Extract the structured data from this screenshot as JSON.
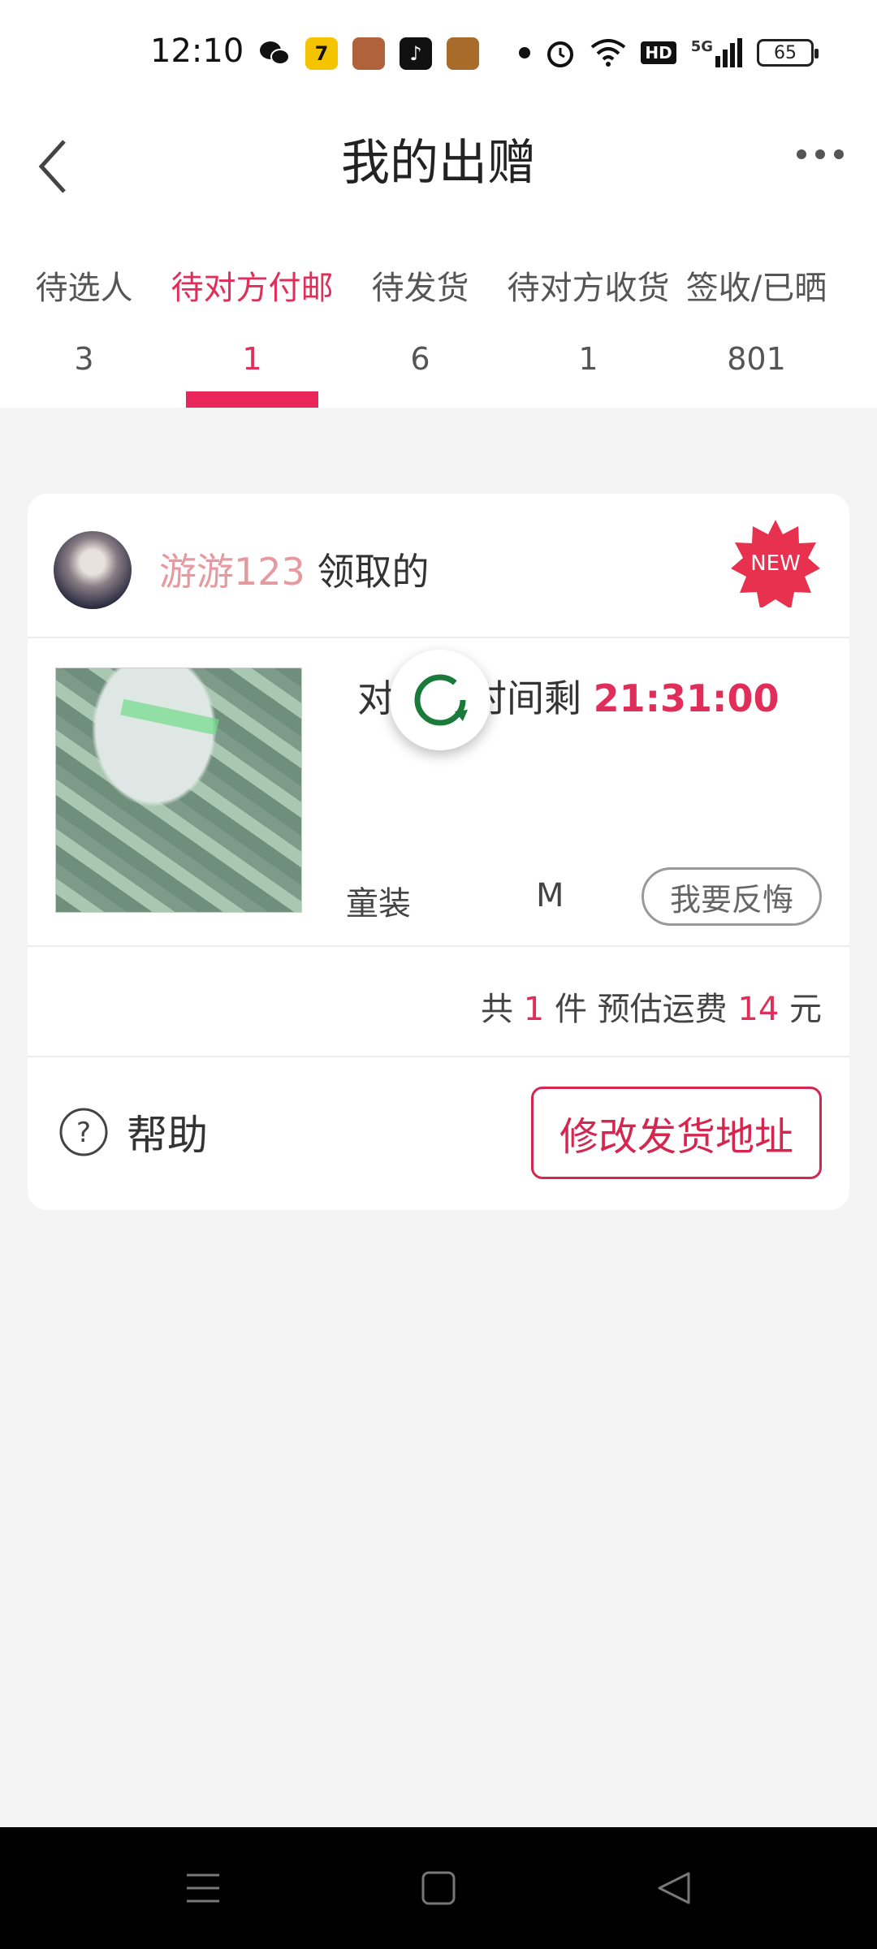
{
  "status_bar": {
    "time": "12:10",
    "network": "5G",
    "hd": "HD",
    "battery": "65",
    "app_icons": [
      "wechat-icon",
      "app-7-icon",
      "game-icon",
      "tiktok-icon",
      "game2-icon"
    ]
  },
  "header": {
    "title": "我的出赠",
    "back_icon": "chevron-left-icon",
    "more_icon": "more-dots-icon"
  },
  "tabs": [
    {
      "label": "待选人",
      "count": "3",
      "active": false
    },
    {
      "label": "待对方付邮",
      "count": "1",
      "active": true
    },
    {
      "label": "待发货",
      "count": "6",
      "active": false
    },
    {
      "label": "待对方收货",
      "count": "1",
      "active": false
    },
    {
      "label": "签收/已晒",
      "count": "801",
      "active": false
    }
  ],
  "order": {
    "user_name": "游游123",
    "user_suffix": "领取的",
    "new_badge": "NEW",
    "pay_prefix": "对方付时间剩",
    "pay_time": "21:31:00",
    "category": "童装",
    "size": "M",
    "regret_button": "我要反悔",
    "summary": {
      "prefix": "共",
      "count": "1",
      "mid": "件 预估运费",
      "fee": "14",
      "unit": "元"
    },
    "help_label": "帮助",
    "modify_address_button": "修改发货地址"
  },
  "colors": {
    "accent": "#e02e5a",
    "username": "#e69aa0",
    "badge": "#e8304f"
  }
}
